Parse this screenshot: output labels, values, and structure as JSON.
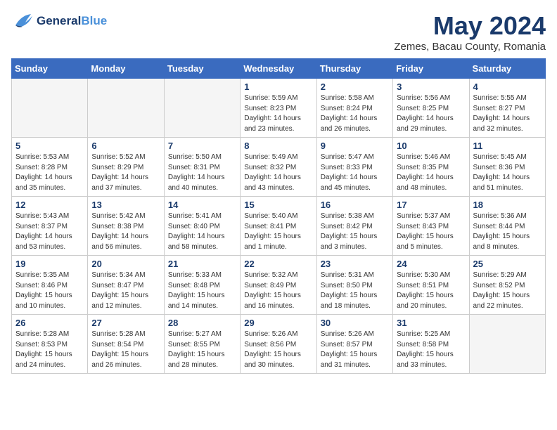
{
  "logo": {
    "line1": "General",
    "line2": "Blue"
  },
  "title": "May 2024",
  "subtitle": "Zemes, Bacau County, Romania",
  "days_of_week": [
    "Sunday",
    "Monday",
    "Tuesday",
    "Wednesday",
    "Thursday",
    "Friday",
    "Saturday"
  ],
  "weeks": [
    [
      {
        "num": "",
        "info": ""
      },
      {
        "num": "",
        "info": ""
      },
      {
        "num": "",
        "info": ""
      },
      {
        "num": "1",
        "info": "Sunrise: 5:59 AM\nSunset: 8:23 PM\nDaylight: 14 hours\nand 23 minutes."
      },
      {
        "num": "2",
        "info": "Sunrise: 5:58 AM\nSunset: 8:24 PM\nDaylight: 14 hours\nand 26 minutes."
      },
      {
        "num": "3",
        "info": "Sunrise: 5:56 AM\nSunset: 8:25 PM\nDaylight: 14 hours\nand 29 minutes."
      },
      {
        "num": "4",
        "info": "Sunrise: 5:55 AM\nSunset: 8:27 PM\nDaylight: 14 hours\nand 32 minutes."
      }
    ],
    [
      {
        "num": "5",
        "info": "Sunrise: 5:53 AM\nSunset: 8:28 PM\nDaylight: 14 hours\nand 35 minutes."
      },
      {
        "num": "6",
        "info": "Sunrise: 5:52 AM\nSunset: 8:29 PM\nDaylight: 14 hours\nand 37 minutes."
      },
      {
        "num": "7",
        "info": "Sunrise: 5:50 AM\nSunset: 8:31 PM\nDaylight: 14 hours\nand 40 minutes."
      },
      {
        "num": "8",
        "info": "Sunrise: 5:49 AM\nSunset: 8:32 PM\nDaylight: 14 hours\nand 43 minutes."
      },
      {
        "num": "9",
        "info": "Sunrise: 5:47 AM\nSunset: 8:33 PM\nDaylight: 14 hours\nand 45 minutes."
      },
      {
        "num": "10",
        "info": "Sunrise: 5:46 AM\nSunset: 8:35 PM\nDaylight: 14 hours\nand 48 minutes."
      },
      {
        "num": "11",
        "info": "Sunrise: 5:45 AM\nSunset: 8:36 PM\nDaylight: 14 hours\nand 51 minutes."
      }
    ],
    [
      {
        "num": "12",
        "info": "Sunrise: 5:43 AM\nSunset: 8:37 PM\nDaylight: 14 hours\nand 53 minutes."
      },
      {
        "num": "13",
        "info": "Sunrise: 5:42 AM\nSunset: 8:38 PM\nDaylight: 14 hours\nand 56 minutes."
      },
      {
        "num": "14",
        "info": "Sunrise: 5:41 AM\nSunset: 8:40 PM\nDaylight: 14 hours\nand 58 minutes."
      },
      {
        "num": "15",
        "info": "Sunrise: 5:40 AM\nSunset: 8:41 PM\nDaylight: 15 hours\nand 1 minute."
      },
      {
        "num": "16",
        "info": "Sunrise: 5:38 AM\nSunset: 8:42 PM\nDaylight: 15 hours\nand 3 minutes."
      },
      {
        "num": "17",
        "info": "Sunrise: 5:37 AM\nSunset: 8:43 PM\nDaylight: 15 hours\nand 5 minutes."
      },
      {
        "num": "18",
        "info": "Sunrise: 5:36 AM\nSunset: 8:44 PM\nDaylight: 15 hours\nand 8 minutes."
      }
    ],
    [
      {
        "num": "19",
        "info": "Sunrise: 5:35 AM\nSunset: 8:46 PM\nDaylight: 15 hours\nand 10 minutes."
      },
      {
        "num": "20",
        "info": "Sunrise: 5:34 AM\nSunset: 8:47 PM\nDaylight: 15 hours\nand 12 minutes."
      },
      {
        "num": "21",
        "info": "Sunrise: 5:33 AM\nSunset: 8:48 PM\nDaylight: 15 hours\nand 14 minutes."
      },
      {
        "num": "22",
        "info": "Sunrise: 5:32 AM\nSunset: 8:49 PM\nDaylight: 15 hours\nand 16 minutes."
      },
      {
        "num": "23",
        "info": "Sunrise: 5:31 AM\nSunset: 8:50 PM\nDaylight: 15 hours\nand 18 minutes."
      },
      {
        "num": "24",
        "info": "Sunrise: 5:30 AM\nSunset: 8:51 PM\nDaylight: 15 hours\nand 20 minutes."
      },
      {
        "num": "25",
        "info": "Sunrise: 5:29 AM\nSunset: 8:52 PM\nDaylight: 15 hours\nand 22 minutes."
      }
    ],
    [
      {
        "num": "26",
        "info": "Sunrise: 5:28 AM\nSunset: 8:53 PM\nDaylight: 15 hours\nand 24 minutes."
      },
      {
        "num": "27",
        "info": "Sunrise: 5:28 AM\nSunset: 8:54 PM\nDaylight: 15 hours\nand 26 minutes."
      },
      {
        "num": "28",
        "info": "Sunrise: 5:27 AM\nSunset: 8:55 PM\nDaylight: 15 hours\nand 28 minutes."
      },
      {
        "num": "29",
        "info": "Sunrise: 5:26 AM\nSunset: 8:56 PM\nDaylight: 15 hours\nand 30 minutes."
      },
      {
        "num": "30",
        "info": "Sunrise: 5:26 AM\nSunset: 8:57 PM\nDaylight: 15 hours\nand 31 minutes."
      },
      {
        "num": "31",
        "info": "Sunrise: 5:25 AM\nSunset: 8:58 PM\nDaylight: 15 hours\nand 33 minutes."
      },
      {
        "num": "",
        "info": ""
      }
    ]
  ]
}
